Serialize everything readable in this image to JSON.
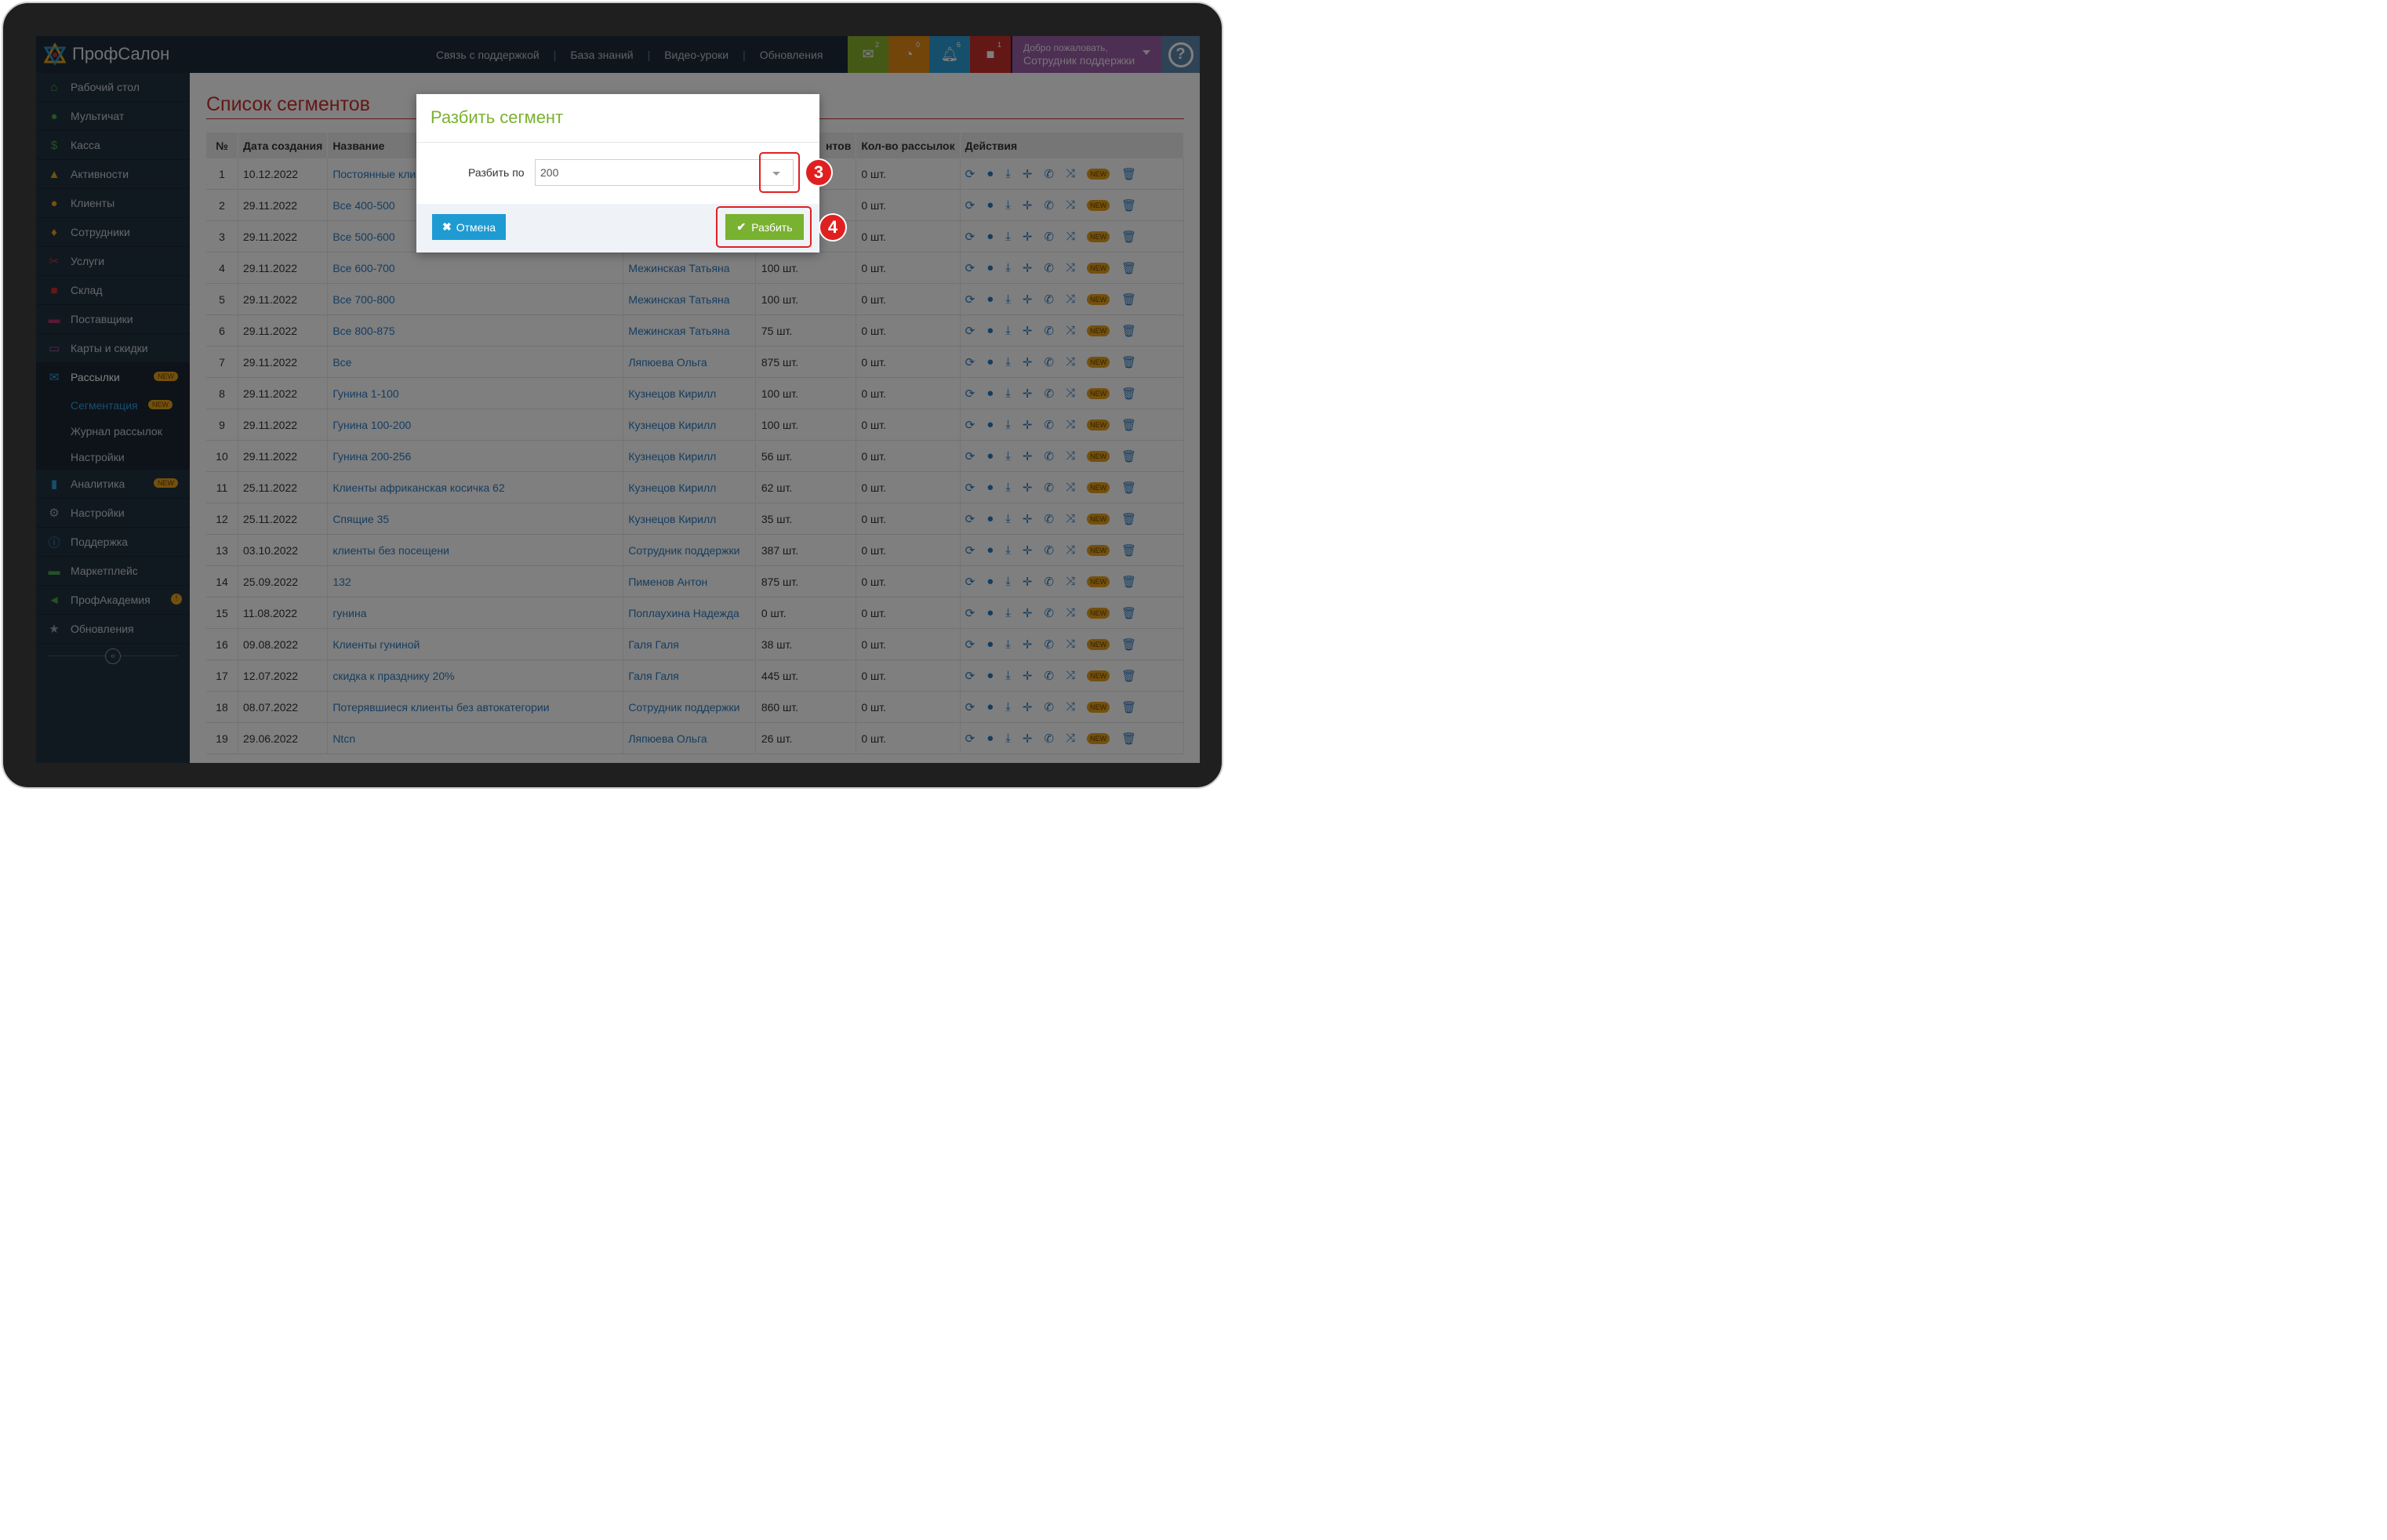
{
  "app": {
    "brand": "ПрофСалон"
  },
  "topbar": {
    "links": [
      "Связь с поддержкой",
      "База знаний",
      "Видео-уроки",
      "Обновления"
    ],
    "tiles": [
      {
        "icon": "mail-icon",
        "count": "2",
        "color": "#8ab22f"
      },
      {
        "icon": "tasks-icon",
        "count": "0",
        "color": "#e58b16"
      },
      {
        "icon": "bell-icon",
        "count": "6",
        "color": "#2c9fd6"
      },
      {
        "icon": "gift-icon",
        "count": "1",
        "color": "#c9302c"
      }
    ],
    "welcome_line1": "Добро пожаловать,",
    "welcome_line2": "Сотрудник поддержки",
    "help_glyph": "?"
  },
  "sidebar": {
    "items": [
      {
        "label": "Рабочий стол",
        "icon": "home-icon",
        "color": "#46a546"
      },
      {
        "label": "Мультичат",
        "icon": "chat-icon",
        "color": "#46a546"
      },
      {
        "label": "Касса",
        "icon": "dollar-icon",
        "color": "#46a546"
      },
      {
        "label": "Активности",
        "icon": "bell-icon",
        "color": "#e6a11a"
      },
      {
        "label": "Клиенты",
        "icon": "users-icon",
        "color": "#e6a11a"
      },
      {
        "label": "Сотрудники",
        "icon": "person-icon",
        "color": "#e6a11a"
      },
      {
        "label": "Услуги",
        "icon": "scissors-icon",
        "color": "#c9302c"
      },
      {
        "label": "Склад",
        "icon": "box-icon",
        "color": "#c9302c"
      },
      {
        "label": "Поставщики",
        "icon": "cart-icon",
        "color": "#b0316d"
      },
      {
        "label": "Карты и скидки",
        "icon": "card-icon",
        "color": "#9a5fa6"
      },
      {
        "label": "Рассылки",
        "icon": "envelope-icon",
        "color": "#2c9fd6",
        "badge": "NEW"
      }
    ],
    "subitems": [
      {
        "label": "Сегментация",
        "badge": "NEW"
      },
      {
        "label": "Журнал рассылок"
      },
      {
        "label": "Настройки"
      }
    ],
    "items_after": [
      {
        "label": "Аналитика",
        "icon": "file-icon",
        "color": "#2c9fd6",
        "badge": "NEW"
      },
      {
        "label": "Настройки",
        "icon": "gears-icon",
        "color": "#9aa5af"
      },
      {
        "label": "Поддержка",
        "icon": "info-icon",
        "color": "#2c9fd6"
      },
      {
        "label": "Маркетплейс",
        "icon": "cart-icon",
        "color": "#46a546"
      },
      {
        "label": "ПрофАкадемия",
        "icon": "megaphone-icon",
        "color": "#46a546",
        "badge": "!"
      },
      {
        "label": "Обновления",
        "icon": "star-icon",
        "color": "#9aa5af"
      }
    ]
  },
  "page": {
    "title": "Список сегментов",
    "columns": [
      "№",
      "Дата создания",
      "Название",
      "",
      "",
      "нтов",
      "Кол-во рассылок",
      "Действия"
    ],
    "new_badge": "NEW",
    "rows": [
      {
        "n": "1",
        "date": "10.12.2022",
        "name": "Постоянные кли",
        "author": "",
        "clients": "",
        "mailings": "0 шт."
      },
      {
        "n": "2",
        "date": "29.11.2022",
        "name": "Все 400-500",
        "author": "",
        "clients": "",
        "mailings": "0 шт."
      },
      {
        "n": "3",
        "date": "29.11.2022",
        "name": "Все 500-600",
        "author": "",
        "clients": "",
        "mailings": "0 шт."
      },
      {
        "n": "4",
        "date": "29.11.2022",
        "name": "Все 600-700",
        "author": "Межинская Татьяна",
        "clients": "100 шт.",
        "mailings": "0 шт."
      },
      {
        "n": "5",
        "date": "29.11.2022",
        "name": "Все 700-800",
        "author": "Межинская Татьяна",
        "clients": "100 шт.",
        "mailings": "0 шт."
      },
      {
        "n": "6",
        "date": "29.11.2022",
        "name": "Все 800-875",
        "author": "Межинская Татьяна",
        "clients": "75 шт.",
        "mailings": "0 шт."
      },
      {
        "n": "7",
        "date": "29.11.2022",
        "name": "Все",
        "author": "Ляпюева Ольга",
        "clients": "875 шт.",
        "mailings": "0 шт."
      },
      {
        "n": "8",
        "date": "29.11.2022",
        "name": "Гунина 1-100",
        "author": "Кузнецов Кирилл",
        "clients": "100 шт.",
        "mailings": "0 шт."
      },
      {
        "n": "9",
        "date": "29.11.2022",
        "name": "Гунина 100-200",
        "author": "Кузнецов Кирилл",
        "clients": "100 шт.",
        "mailings": "0 шт."
      },
      {
        "n": "10",
        "date": "29.11.2022",
        "name": "Гунина 200-256",
        "author": "Кузнецов Кирилл",
        "clients": "56 шт.",
        "mailings": "0 шт."
      },
      {
        "n": "11",
        "date": "25.11.2022",
        "name": "Клиенты африканская косичка 62",
        "author": "Кузнецов Кирилл",
        "clients": "62 шт.",
        "mailings": "0 шт."
      },
      {
        "n": "12",
        "date": "25.11.2022",
        "name": "Спящие 35",
        "author": "Кузнецов Кирилл",
        "clients": "35 шт.",
        "mailings": "0 шт."
      },
      {
        "n": "13",
        "date": "03.10.2022",
        "name": "клиенты без посещени",
        "author": "Сотрудник поддержки",
        "clients": "387 шт.",
        "mailings": "0 шт."
      },
      {
        "n": "14",
        "date": "25.09.2022",
        "name": "132",
        "author": "Пименов Антон",
        "clients": "875 шт.",
        "mailings": "0 шт."
      },
      {
        "n": "15",
        "date": "11.08.2022",
        "name": "гунина",
        "author": "Поплаухина Надежда",
        "clients": "0 шт.",
        "mailings": "0 шт."
      },
      {
        "n": "16",
        "date": "09.08.2022",
        "name": "Клиенты гуниной",
        "author": "Галя Галя",
        "clients": "38 шт.",
        "mailings": "0 шт."
      },
      {
        "n": "17",
        "date": "12.07.2022",
        "name": "скидка к празднику 20%",
        "author": "Галя Галя",
        "clients": "445 шт.",
        "mailings": "0 шт."
      },
      {
        "n": "18",
        "date": "08.07.2022",
        "name": "Потерявшиеся клиенты без автокатегории",
        "author": "Сотрудник поддержки",
        "clients": "860 шт.",
        "mailings": "0 шт."
      },
      {
        "n": "19",
        "date": "29.06.2022",
        "name": "Ntcn",
        "author": "Ляпюева Ольга",
        "clients": "26 шт.",
        "mailings": "0 шт."
      }
    ]
  },
  "modal": {
    "title": "Разбить сегмент",
    "field_label": "Разбить по",
    "select_value": "200",
    "cancel_label": "Отмена",
    "submit_label": "Разбить"
  },
  "annotations": {
    "step3": "3",
    "step4": "4",
    "color": "#e02020"
  }
}
